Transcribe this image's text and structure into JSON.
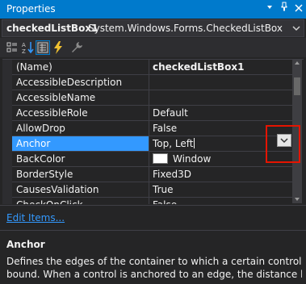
{
  "window": {
    "title": "Properties",
    "controls": {
      "pin": "▾",
      "pin2": "⊣",
      "close": "✕"
    }
  },
  "object_selector": {
    "name": "checkedListBox1",
    "type": "System.Windows.Forms.CheckedListBox"
  },
  "toolbar": {
    "buttons": [
      "categorized-icon",
      "alphabetical-icon",
      "properties-icon",
      "events-icon",
      "property-pages-icon"
    ],
    "active": "properties-icon"
  },
  "grid": {
    "rows": [
      {
        "name": "(Name)",
        "value": "checkedListBox1",
        "bold": true
      },
      {
        "name": "AccessibleDescription",
        "value": ""
      },
      {
        "name": "AccessibleName",
        "value": ""
      },
      {
        "name": "AccessibleRole",
        "value": "Default"
      },
      {
        "name": "AllowDrop",
        "value": "False"
      },
      {
        "name": "Anchor",
        "value": "Top, Left",
        "selected": true
      },
      {
        "name": "BackColor",
        "value": "Window",
        "swatch": "#ffffff"
      },
      {
        "name": "BorderStyle",
        "value": "Fixed3D"
      },
      {
        "name": "CausesValidation",
        "value": "True"
      },
      {
        "name": "CheckOnClick",
        "value": "False"
      }
    ]
  },
  "commands": {
    "edit_items": "Edit Items..."
  },
  "description": {
    "title": "Anchor",
    "line1": "Defines the edges of the container to which a certain control is",
    "line2": "bound. When a control is anchored to an edge, the distance betwe..."
  },
  "colors": {
    "accent": "#007acc",
    "selection": "#3399ff",
    "highlight": "#e51400",
    "link": "#3399ff"
  }
}
